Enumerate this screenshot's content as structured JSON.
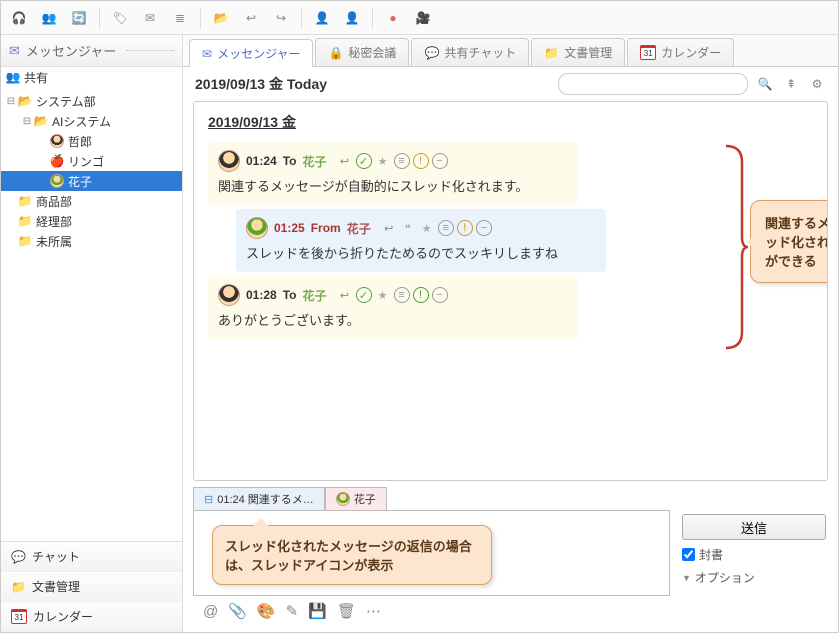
{
  "toolbar_icons": [
    "headset",
    "group-add",
    "user-refresh",
    "tag",
    "mail-new",
    "thread",
    "folder-open",
    "reply-all",
    "reply",
    "users",
    "user-minus",
    "record",
    "camera"
  ],
  "sidebar": {
    "header_label": "メッセンジャー",
    "share_label": "共有",
    "tree": [
      {
        "label": "システム部",
        "type": "folder-open",
        "depth": 0,
        "expand": "-"
      },
      {
        "label": "AIシステム",
        "type": "folder-open",
        "depth": 1,
        "expand": "-"
      },
      {
        "label": "哲郎",
        "type": "avatar-boy",
        "depth": 2,
        "expand": ""
      },
      {
        "label": "リンゴ",
        "type": "apple",
        "depth": 2,
        "expand": ""
      },
      {
        "label": "花子",
        "type": "avatar-girl",
        "depth": 2,
        "expand": "",
        "selected": true
      },
      {
        "label": "商品部",
        "type": "folder",
        "depth": 0,
        "expand": ""
      },
      {
        "label": "経理部",
        "type": "folder",
        "depth": 0,
        "expand": ""
      },
      {
        "label": "未所属",
        "type": "folder",
        "depth": 0,
        "expand": ""
      }
    ],
    "bottom_nav": [
      {
        "icon": "💬",
        "label": "チャット",
        "color": "#e6c94f"
      },
      {
        "icon": "📁",
        "label": "文書管理",
        "color": "#e6b84f"
      },
      {
        "icon": "31",
        "label": "カレンダー",
        "color": "#3a6fc9",
        "cal": true
      }
    ]
  },
  "tabs": [
    {
      "icon": "✉",
      "label": "メッセンジャー",
      "active": true,
      "color": "#6a7fc9"
    },
    {
      "icon": "🔒",
      "label": "秘密会議",
      "color": "#bba255"
    },
    {
      "icon": "💬",
      "label": "共有チャット",
      "color": "#c9c255"
    },
    {
      "icon": "📁",
      "label": "文書管理",
      "color": "#e6b84f"
    },
    {
      "icon": "31",
      "label": "カレンダー",
      "color": "#3a6fc9",
      "cal": true
    }
  ],
  "datebar": {
    "label": "2019/09/13 金 Today",
    "search_placeholder": ""
  },
  "day_header": "2019/09/13 金",
  "messages": [
    {
      "kind": "sent",
      "time": "01:24",
      "dir": "To",
      "who": "花子",
      "body": "関連するメッセージが自動的にスレッド化されます。",
      "actions": [
        "reply",
        "check",
        "star",
        "list",
        "warn",
        "minus"
      ]
    },
    {
      "kind": "recv",
      "time": "01:25",
      "dir": "From",
      "who": "花子",
      "body": "スレッドを後から折りたためるのでスッキリしますね",
      "actions": [
        "reply",
        "quote",
        "star",
        "list",
        "warn",
        "minus"
      ]
    },
    {
      "kind": "sent",
      "time": "01:28",
      "dir": "To",
      "who": "花子",
      "body": "ありがとうございます。",
      "actions": [
        "reply",
        "check",
        "star",
        "list",
        "warn-g",
        "minus"
      ]
    }
  ],
  "callout1": "関連するメッセージが自動的にスレッド化され、後から折りたたむことができる",
  "compose": {
    "reply_tab": "01:24 関連するメ…",
    "user_tab": "花子",
    "send_label": "送信",
    "sealed_label": "封書",
    "option_label": "オプション"
  },
  "callout2": "スレッド化されたメッセージの返信の場合は、スレッドアイコンが表示",
  "compose_icons": [
    "@",
    "clip",
    "palette",
    "edit",
    "save",
    "trash",
    "more"
  ]
}
